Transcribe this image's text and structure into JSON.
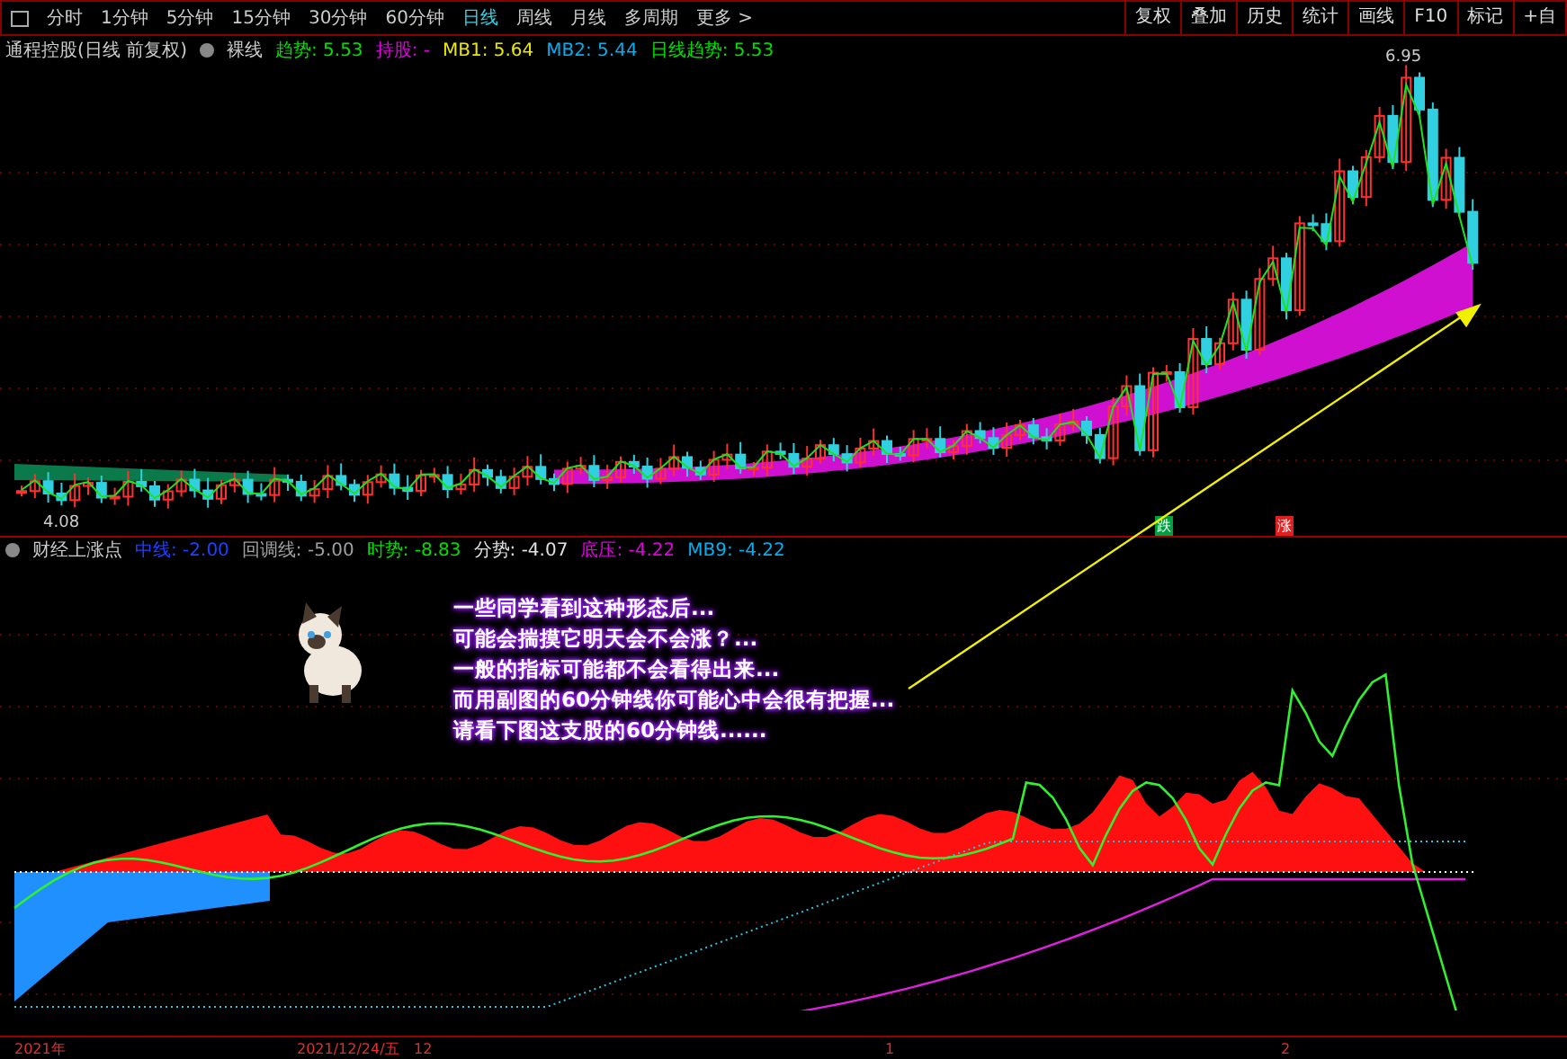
{
  "toolbar": {
    "period_tabs": [
      {
        "label": "分时",
        "selected": false
      },
      {
        "label": "1分钟",
        "selected": false
      },
      {
        "label": "5分钟",
        "selected": false
      },
      {
        "label": "15分钟",
        "selected": false
      },
      {
        "label": "30分钟",
        "selected": false
      },
      {
        "label": "60分钟",
        "selected": false
      },
      {
        "label": "日线",
        "selected": true
      },
      {
        "label": "周线",
        "selected": false
      },
      {
        "label": "月线",
        "selected": false
      },
      {
        "label": "多周期",
        "selected": false
      },
      {
        "label": "更多 >",
        "selected": false
      }
    ],
    "buttons": [
      "复权",
      "叠加",
      "历史",
      "统计",
      "画线",
      "F10",
      "标记",
      "+自"
    ]
  },
  "main_chart": {
    "legend": {
      "title": "通程控股(日线 前复权)",
      "mode": "裸线",
      "items": [
        {
          "label": "趋势: 5.53",
          "color": "#00e000"
        },
        {
          "label": "持股: -",
          "color": "#e000e0"
        },
        {
          "label": "MB1: 5.64",
          "color": "#e8e800"
        },
        {
          "label": "MB2: 5.44",
          "color": "#00b0f0"
        },
        {
          "label": "日线趋势: 5.53",
          "color": "#00e000"
        }
      ]
    },
    "high_label": "6.95",
    "low_label": "4.08",
    "signals": [
      {
        "label": "跌",
        "color": "#00a040"
      },
      {
        "label": "涨",
        "color": "#e02020"
      }
    ]
  },
  "sub_chart": {
    "legend": {
      "title": "财经上涨点",
      "items": [
        {
          "label": "中线: -2.00",
          "color": "#2040ff"
        },
        {
          "label": "回调线: -5.00",
          "color": "#a0a0a0"
        },
        {
          "label": "时势: -8.83",
          "color": "#00e000"
        },
        {
          "label": "分势: -4.07",
          "color": "#e0e0e0"
        },
        {
          "label": "底压: -4.22",
          "color": "#e000e0"
        },
        {
          "label": "MB9: -4.22",
          "color": "#00b0f0"
        }
      ]
    },
    "annotation": [
      "一些同学看到这种形态后...",
      "可能会揣摸它明天会不会涨？...",
      "一般的指标可能都不会看得出来...",
      "而用副图的60分钟线你可能心中会很有把握...",
      "请看下图这支股的60分钟线......"
    ]
  },
  "time_axis": [
    "2021年",
    "2021/12/24/五",
    "12",
    "1",
    "2"
  ]
}
